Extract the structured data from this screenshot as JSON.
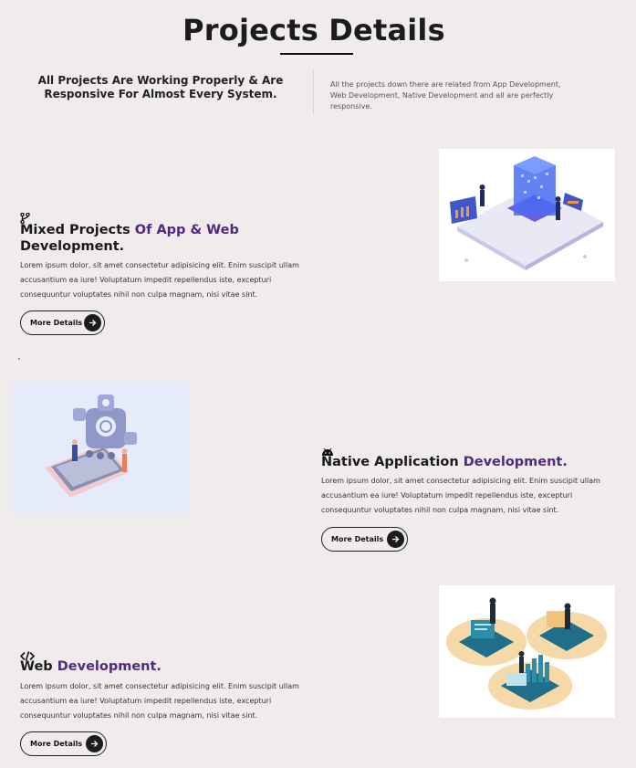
{
  "header": {
    "title": "Projects Details",
    "intro_left": "All Projects Are Working Properly & Are Responsive For Almost Every System.",
    "intro_right": "All the projects down there are related from App Development, Web Development, Native Development and all are perfectly responsive."
  },
  "sections": [
    {
      "icon": "branch-icon",
      "title_plain": "Mixed Projects ",
      "title_accent_1": "Of",
      "title_mid": " App & Web",
      "title_end": "Development.",
      "text": "Lorem ipsum dolor, sit amet consectetur adipisicing elit. Enim suscipit ullam accusantium ea iure! Voluptatum impedit repellendus iste, excepturi consequuntur voluptates nihil non culpa magnam, nisi vitae sint.",
      "button": "More Details"
    },
    {
      "icon": "android-icon",
      "title_plain": "Native Application ",
      "title_accent": "Development.",
      "text": "Lorem ipsum dolor, sit amet consectetur adipisicing elit. Enim suscipit ullam accusantium ea iure! Voluptatum impedit repellendus iste, excepturi consequuntur voluptates nihil non culpa magnam, nisi vitae sint.",
      "button": "More Details"
    },
    {
      "icon": "code-icon",
      "title_plain": "Web ",
      "title_accent": "Development.",
      "text": "Lorem ipsum dolor, sit amet consectetur adipisicing elit. Enim suscipit ullam accusantium ea iure! Voluptatum impedit repellendus iste, excepturi consequuntur voluptates nihil non culpa magnam, nisi vitae sint.",
      "button": "More Details"
    }
  ],
  "colors": {
    "background": "#f0ecec",
    "accent": "#4f2a7e",
    "button_arrow_bg": "#1c1c1c"
  }
}
